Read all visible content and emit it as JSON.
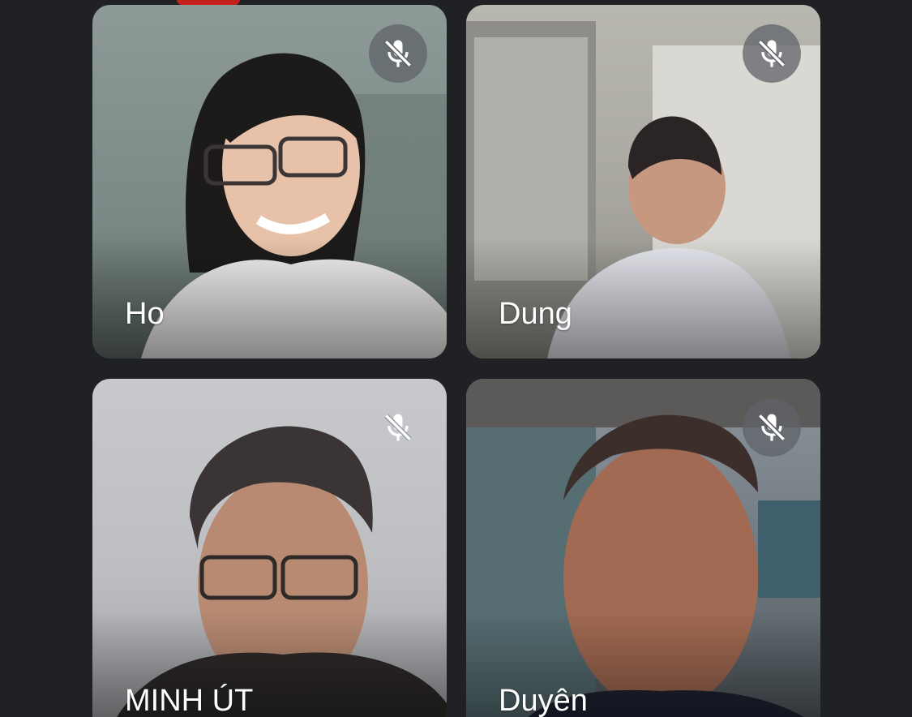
{
  "participants": [
    {
      "name": "Ho",
      "muted": true,
      "mic_icon": "mic-off-icon"
    },
    {
      "name": "Dung",
      "muted": true,
      "mic_icon": "mic-off-icon"
    },
    {
      "name": "MINH ÚT",
      "muted": true,
      "mic_icon": "mic-off-icon"
    },
    {
      "name": "Duyên",
      "muted": true,
      "mic_icon": "mic-off-icon"
    }
  ],
  "colors": {
    "background": "#202124",
    "indicator": "#c5221f",
    "mute_badge": "#5f6368",
    "name_text": "#ffffff"
  }
}
